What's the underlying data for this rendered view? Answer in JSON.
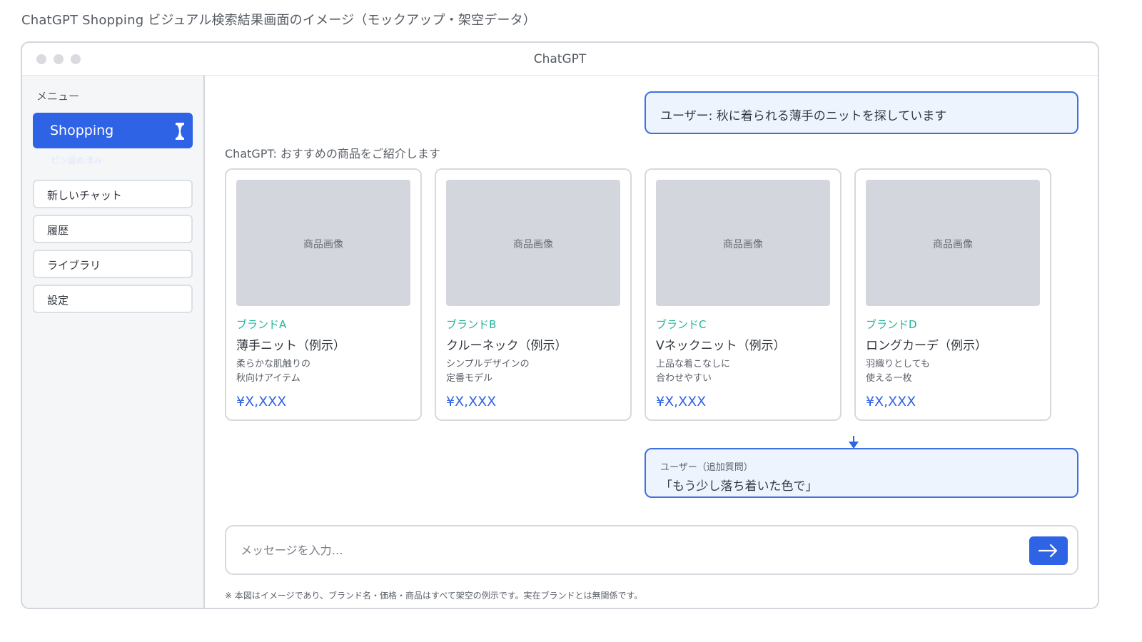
{
  "caption": "ChatGPT Shopping ビジュアル検索結果画面のイメージ（モックアップ・架空データ）",
  "window": {
    "title": "ChatGPT"
  },
  "sidebar": {
    "menu_label": "メニュー",
    "active_item": {
      "label": "Shopping",
      "icon": "pin-icon",
      "note": "ピン留め済み"
    },
    "items": [
      {
        "label": "新しいチャット"
      },
      {
        "label": "履歴"
      },
      {
        "label": "ライブラリ"
      },
      {
        "label": "設定"
      }
    ]
  },
  "chat": {
    "user_message": "ユーザー: 秋に着られる薄手のニットを探しています",
    "assistant_intro": "ChatGPT: おすすめの商品をご紹介します",
    "products": [
      {
        "image_label": "商品画像",
        "brand": "ブランドA",
        "name": "薄手ニット（例示）",
        "desc_line1": "柔らかな肌触りの",
        "desc_line2": "秋向けアイテム",
        "price": "¥X,XXX"
      },
      {
        "image_label": "商品画像",
        "brand": "ブランドB",
        "name": "クルーネック（例示）",
        "desc_line1": "シンプルデザインの",
        "desc_line2": "定番モデル",
        "price": "¥X,XXX"
      },
      {
        "image_label": "商品画像",
        "brand": "ブランドC",
        "name": "Vネックニット（例示）",
        "desc_line1": "上品な着こなしに",
        "desc_line2": "合わせやすい",
        "price": "¥X,XXX"
      },
      {
        "image_label": "商品画像",
        "brand": "ブランドD",
        "name": "ロングカーデ（例示）",
        "desc_line1": "羽織りとしても",
        "desc_line2": "使える一枚",
        "price": "¥X,XXX"
      }
    ],
    "followup": {
      "label": "ユーザー（追加質問）",
      "text": "「もう少し落ち着いた色で」"
    }
  },
  "composer": {
    "placeholder": "メッセージを入力…",
    "send_icon": "arrow-right-icon"
  },
  "footnote": "※ 本図はイメージであり、ブランド名・価格・商品はすべて架空の例示です。実在ブランドとは無関係です。",
  "colors": {
    "accent": "#2f63e6",
    "brand_text": "#20b49a",
    "bubble_bg": "#eef4fd",
    "image_placeholder": "#d3d6dd"
  }
}
